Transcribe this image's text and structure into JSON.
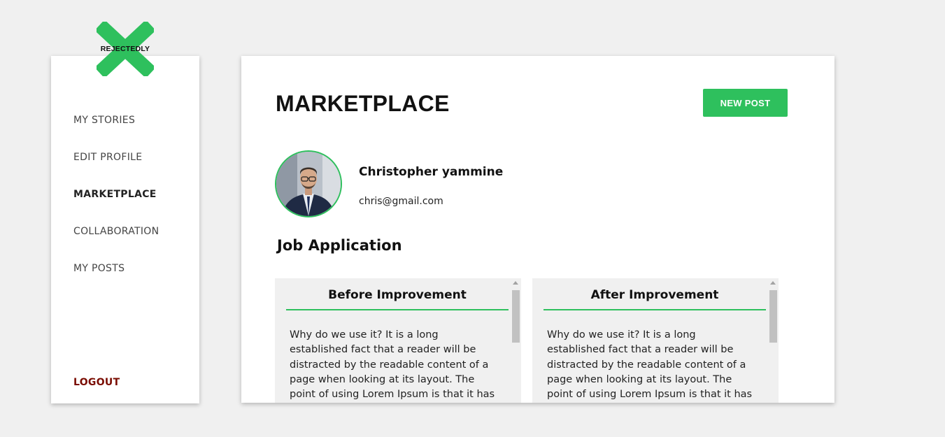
{
  "brand": {
    "name": "REJECTEDLY",
    "accent_color": "#2ec05d",
    "logo_icon": "x-icon"
  },
  "sidebar": {
    "items": [
      {
        "label": "MY STORIES",
        "active": false
      },
      {
        "label": "EDIT PROFILE",
        "active": false
      },
      {
        "label": "MARKETPLACE",
        "active": true
      },
      {
        "label": "COLLABORATION",
        "active": false
      },
      {
        "label": "MY POSTS",
        "active": false
      }
    ],
    "logout_label": "LOGOUT",
    "logout_color": "#7a0c00"
  },
  "main": {
    "title": "MARKETPLACE",
    "new_post_label": "NEW POST",
    "user": {
      "name": "Christopher yammine",
      "email": "chris@gmail.com"
    },
    "section_title": "Job Application",
    "panels": [
      {
        "title": "Before Improvement",
        "text": "Why do we use it? It is a long established fact that a reader will be distracted by the readable content of a page when looking at its layout. The point of using Lorem Ipsum is that it has a more-or-less"
      },
      {
        "title": "After Improvement",
        "text": "Why do we use it? It is a long established fact that a reader will be distracted by the readable content of a page when looking at its layout. The point of using Lorem Ipsum is that it has a more-or-less"
      }
    ]
  }
}
